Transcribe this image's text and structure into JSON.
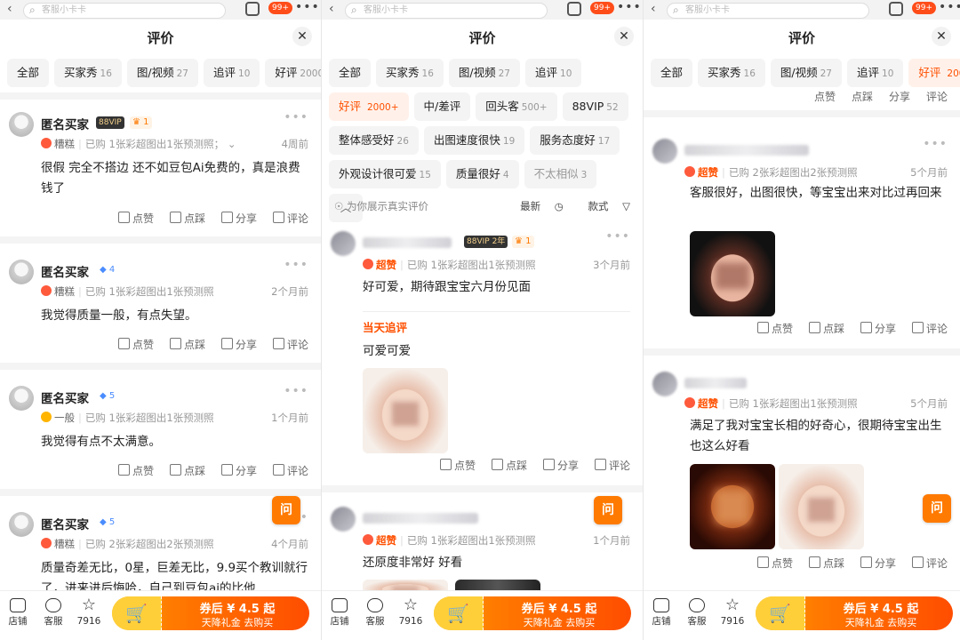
{
  "colors": {
    "accent": "#ff5000",
    "vip": "#333333",
    "buy_gradient_start": "#ffb000",
    "buy_gradient_end": "#ff4d00"
  },
  "topbar": {
    "search_placeholder": "客服小卡卡",
    "cart_badge": "99+"
  },
  "header": {
    "title": "评价",
    "close_icon": "close-icon"
  },
  "tabs": {
    "all": "全部",
    "buyer_show": "买家秀",
    "buyer_show_count": "16",
    "media": "图/视频",
    "media_count": "27",
    "followup": "追评",
    "followup_count": "10",
    "positive": "好评",
    "positive_count": "2000",
    "positive_count_plus": "2000+",
    "neutral_negative": "中/差评",
    "returning": "回头客",
    "returning_count": "500+",
    "vip": "88VIP",
    "vip_count": "52",
    "overall_feel": "整体感受好",
    "overall_feel_count": "26",
    "fast": "出图速度很快",
    "fast_count": "19",
    "service": "服务态度好",
    "service_count": "17",
    "design": "外观设计很可爱",
    "design_count": "15",
    "quality": "质量很好",
    "quality_count": "4",
    "not_similar": "不太相似",
    "not_similar_count": "3",
    "collapse": "︿"
  },
  "sortbar": {
    "notice": "为你展示真实评价",
    "latest": "最新",
    "style": "款式"
  },
  "actions": {
    "like": "点赞",
    "dislike": "点踩",
    "share": "分享",
    "comment": "评论"
  },
  "panel1": {
    "reviews": [
      {
        "name": "匿名买家",
        "vip": "88VIP",
        "level": "1",
        "rating": "糟糕",
        "purchase": "已购 1张彩超图出1张预测照；",
        "time": "4周前",
        "content": "很假 完全不搭边 还不如豆包Ai免费的，真是浪费钱了"
      },
      {
        "name": "匿名买家",
        "level": "4",
        "rating": "糟糕",
        "purchase": "已购 1张彩超图出1张预测照",
        "time": "2个月前",
        "content": "我觉得质量一般，有点失望。"
      },
      {
        "name": "匿名买家",
        "level": "5",
        "rating": "一般",
        "purchase": "已购 1张彩超图出1张预测照",
        "time": "1个月前",
        "content": "我觉得有点不太满意。"
      },
      {
        "name": "匿名买家",
        "level": "5",
        "rating": "糟糕",
        "purchase": "已购 2张彩超图出2张预测照",
        "time": "4个月前",
        "content": "质量奇差无比，0星，巨差无比，9.9买个教训就行了，进来进后悔哈，自己到豆包ai的比他"
      }
    ]
  },
  "panel2": {
    "reviews": [
      {
        "vip": "88VIP",
        "vip_years": "2年",
        "level": "1",
        "rating": "超赞",
        "purchase": "已购 1张彩超图出1张预测照",
        "time": "3个月前",
        "content": "好可爱，期待跟宝宝六月份见面",
        "followup_label": "当天追评",
        "followup_content": "可爱可爱"
      },
      {
        "rating": "超赞",
        "purchase": "已购 1张彩超图出1张预测照",
        "time": "1个月前",
        "content": "还原度非常好 好看"
      }
    ]
  },
  "panel3": {
    "reviews": [
      {
        "rating": "超赞",
        "purchase": "已购 2张彩超图出2张预测照",
        "time": "5个月前",
        "content": "客服很好，出图很快，等宝宝出来对比过再回来"
      },
      {
        "rating": "超赞",
        "purchase": "已购 1张彩超图出1张预测照",
        "time": "5个月前",
        "content": "满足了我对宝宝长相的好奇心，很期待宝宝出生也这么好看"
      }
    ]
  },
  "ask_button": "问",
  "bottombar": {
    "store": "店铺",
    "service": "客服",
    "favorites": "7916",
    "buy_line1": "券后 ¥ 4.5 起",
    "buy_line2": "天降礼金  去购买"
  }
}
